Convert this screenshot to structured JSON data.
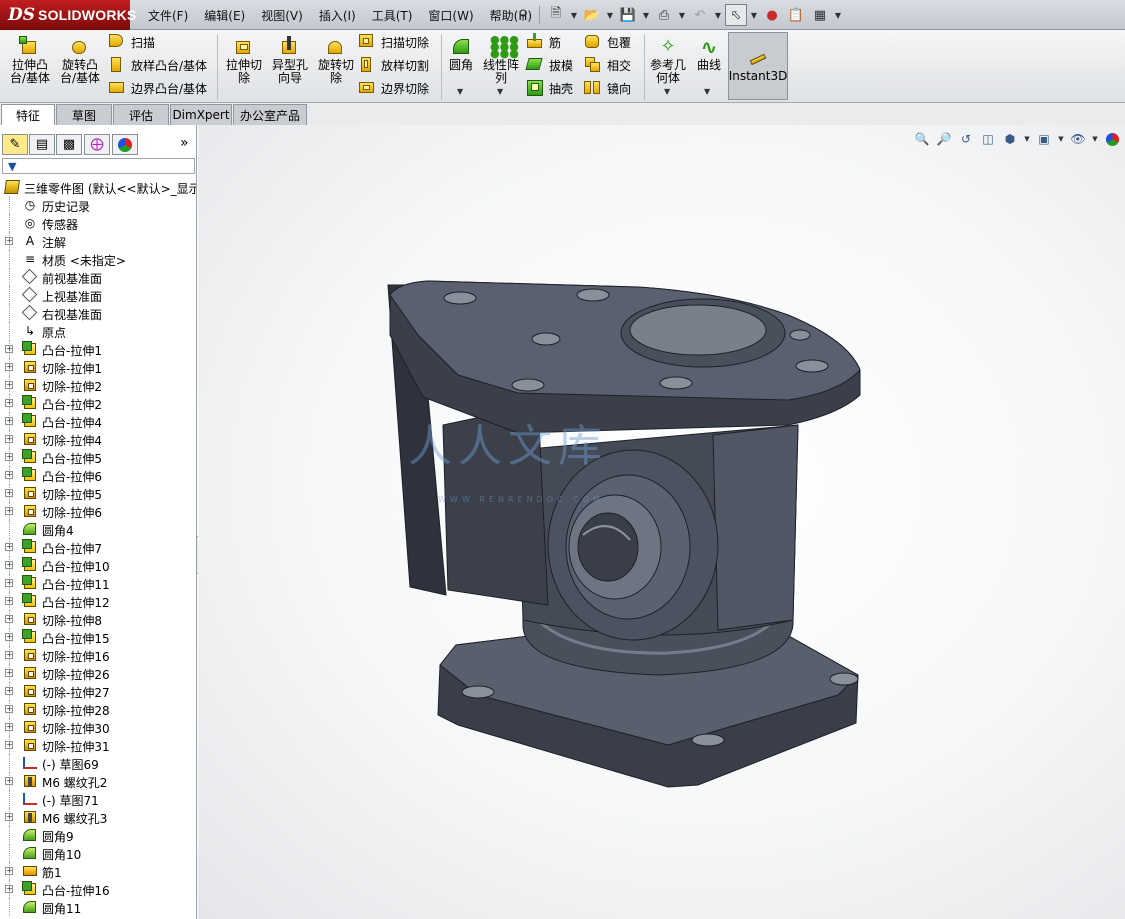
{
  "app": {
    "logo_ds": "DS",
    "logo_name": "SOLIDWORKS"
  },
  "menu": [
    {
      "label": "文件(F)"
    },
    {
      "label": "编辑(E)"
    },
    {
      "label": "视图(V)"
    },
    {
      "label": "插入(I)"
    },
    {
      "label": "工具(T)"
    },
    {
      "label": "窗口(W)"
    },
    {
      "label": "帮助(H)"
    }
  ],
  "command_manager": {
    "extrude_boss": "拉伸凸\n台/基体",
    "revolve_boss": "旋转凸\n台/基体",
    "sweep": "扫描",
    "loft_boss": "放样凸台/基体",
    "boundary_boss": "边界凸台/基体",
    "extrude_cut": "拉伸切\n除",
    "hole_wizard": "异型孔\n向导",
    "revolve_cut": "旋转切\n除",
    "sweep_cut": "扫描切除",
    "loft_cut": "放样切割",
    "boundary_cut": "边界切除",
    "fillet": "圆角",
    "linear_pattern": "线性阵\n列",
    "rib": "筋",
    "draft": "拔模",
    "shell": "抽壳",
    "wrap": "包覆",
    "intersect": "相交",
    "mirror": "镜向",
    "ref_geometry": "参考几\n何体",
    "curves": "曲线",
    "instant3d": "Instant3D"
  },
  "tabs": [
    {
      "label": "特征",
      "active": true
    },
    {
      "label": "草图",
      "active": false
    },
    {
      "label": "评估",
      "active": false
    },
    {
      "label": "DimXpert",
      "active": false
    },
    {
      "label": "办公室产品",
      "active": false
    }
  ],
  "feature_tree": {
    "panel_expand": "»",
    "root": "三维零件图 (默认<<默认>_显示",
    "items": [
      {
        "label": "历史记录",
        "icon": "history-icon",
        "expandable": false
      },
      {
        "label": "传感器",
        "icon": "sensor-icon",
        "expandable": false
      },
      {
        "label": "注解",
        "icon": "annotation-icon",
        "expandable": true
      },
      {
        "label": "材质 <未指定>",
        "icon": "material-icon",
        "expandable": false
      },
      {
        "label": "前视基准面",
        "icon": "plane-icon",
        "expandable": false
      },
      {
        "label": "上视基准面",
        "icon": "plane-icon",
        "expandable": false
      },
      {
        "label": "右视基准面",
        "icon": "plane-icon",
        "expandable": false
      },
      {
        "label": "原点",
        "icon": "origin-icon",
        "expandable": false
      },
      {
        "label": "凸台-拉伸1",
        "icon": "boss-extrude-icon",
        "expandable": true
      },
      {
        "label": "切除-拉伸1",
        "icon": "cut-extrude-icon",
        "expandable": true
      },
      {
        "label": "切除-拉伸2",
        "icon": "cut-extrude-icon",
        "expandable": true
      },
      {
        "label": "凸台-拉伸2",
        "icon": "boss-extrude-icon",
        "expandable": true
      },
      {
        "label": "凸台-拉伸4",
        "icon": "boss-extrude-icon",
        "expandable": true
      },
      {
        "label": "切除-拉伸4",
        "icon": "cut-extrude-icon",
        "expandable": true
      },
      {
        "label": "凸台-拉伸5",
        "icon": "boss-extrude-icon",
        "expandable": true
      },
      {
        "label": "凸台-拉伸6",
        "icon": "boss-extrude-icon",
        "expandable": true
      },
      {
        "label": "切除-拉伸5",
        "icon": "cut-extrude-icon",
        "expandable": true
      },
      {
        "label": "切除-拉伸6",
        "icon": "cut-extrude-icon",
        "expandable": true
      },
      {
        "label": "圆角4",
        "icon": "fillet-icon",
        "expandable": false
      },
      {
        "label": "凸台-拉伸7",
        "icon": "boss-extrude-icon",
        "expandable": true
      },
      {
        "label": "凸台-拉伸10",
        "icon": "boss-extrude-icon",
        "expandable": true
      },
      {
        "label": "凸台-拉伸11",
        "icon": "boss-extrude-icon",
        "expandable": true
      },
      {
        "label": "凸台-拉伸12",
        "icon": "boss-extrude-icon",
        "expandable": true
      },
      {
        "label": "切除-拉伸8",
        "icon": "cut-extrude-icon",
        "expandable": true
      },
      {
        "label": "凸台-拉伸15",
        "icon": "boss-extrude-icon",
        "expandable": true
      },
      {
        "label": "切除-拉伸16",
        "icon": "cut-extrude-icon",
        "expandable": true
      },
      {
        "label": "切除-拉伸26",
        "icon": "cut-extrude-icon",
        "expandable": true
      },
      {
        "label": "切除-拉伸27",
        "icon": "cut-extrude-icon",
        "expandable": true
      },
      {
        "label": "切除-拉伸28",
        "icon": "cut-extrude-icon",
        "expandable": true
      },
      {
        "label": "切除-拉伸30",
        "icon": "cut-extrude-icon",
        "expandable": true
      },
      {
        "label": "切除-拉伸31",
        "icon": "cut-extrude-icon",
        "expandable": true
      },
      {
        "label": "(-) 草图69",
        "icon": "sketch-icon",
        "expandable": false
      },
      {
        "label": "M6 螺纹孔2",
        "icon": "hole-icon",
        "expandable": true
      },
      {
        "label": "(-) 草图71",
        "icon": "sketch-icon",
        "expandable": false
      },
      {
        "label": "M6 螺纹孔3",
        "icon": "hole-icon",
        "expandable": true
      },
      {
        "label": "圆角9",
        "icon": "fillet-icon",
        "expandable": false
      },
      {
        "label": "圆角10",
        "icon": "fillet-icon",
        "expandable": false
      },
      {
        "label": "筋1",
        "icon": "rib-icon",
        "expandable": true
      },
      {
        "label": "凸台-拉伸16",
        "icon": "boss-extrude-icon",
        "expandable": true
      },
      {
        "label": "圆角11",
        "icon": "fillet-icon",
        "expandable": false
      }
    ]
  },
  "watermark": {
    "text": "人人文库",
    "url": "WWW.RENRENDOC.COM"
  },
  "colors": {
    "model_body": "#4d5260",
    "model_light": "#6a6f7e",
    "model_dark": "#2f323c",
    "active_tab": "#ffffff",
    "tab_bg": "#c9cdd2"
  }
}
